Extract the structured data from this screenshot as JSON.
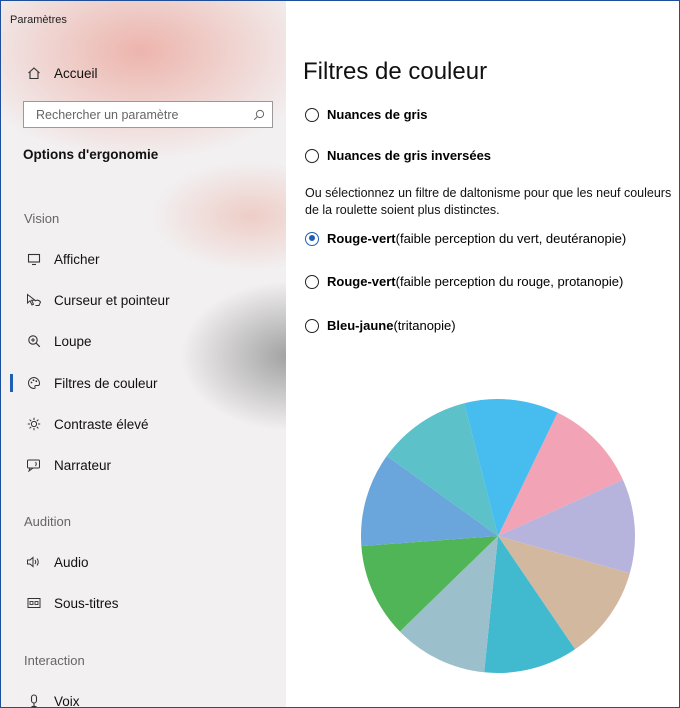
{
  "app": {
    "title": "Paramètres"
  },
  "sidebar": {
    "home": {
      "label": "Accueil",
      "icon": "home-icon"
    },
    "search": {
      "placeholder": "Rechercher un paramètre",
      "icon": "search-icon"
    },
    "group_title": "Options d'ergonomie",
    "sections": [
      {
        "label": "Vision"
      },
      {
        "label": "Audition"
      },
      {
        "label": "Interaction"
      }
    ],
    "items": [
      {
        "label": "Afficher",
        "icon": "monitor-icon"
      },
      {
        "label": "Curseur et pointeur",
        "icon": "pointer-icon"
      },
      {
        "label": "Loupe",
        "icon": "magnifier-icon"
      },
      {
        "label": "Filtres de couleur",
        "icon": "palette-icon",
        "selected": true
      },
      {
        "label": "Contraste élevé",
        "icon": "brightness-icon"
      },
      {
        "label": "Narrateur",
        "icon": "narrator-icon"
      },
      {
        "label": "Audio",
        "icon": "speaker-icon"
      },
      {
        "label": "Sous-titres",
        "icon": "captions-icon"
      },
      {
        "label": "Voix",
        "icon": "microphone-icon"
      }
    ]
  },
  "main": {
    "title": "Filtres de couleur",
    "options": [
      {
        "bold": "Nuances de gris",
        "rest": "",
        "checked": false
      },
      {
        "bold": "Nuances de gris inversées",
        "rest": "",
        "checked": false
      }
    ],
    "description_line1": "Ou sélectionnez un filtre de daltonisme pour que les neuf couleurs",
    "description_line2": "de la roulette soient plus distinctes.",
    "filters": [
      {
        "bold": "Rouge-vert",
        "rest": " (faible perception du vert, deutéranopie)",
        "checked": true
      },
      {
        "bold": "Rouge-vert",
        "rest": " (faible perception du rouge, protanopie)",
        "checked": false
      },
      {
        "bold": "Bleu-jaune",
        "rest": " (tritanopie)",
        "checked": false
      }
    ],
    "color_wheel": {
      "slices": [
        {
          "color": "#f2a3b5"
        },
        {
          "color": "#b6b4dc"
        },
        {
          "color": "#d3b8a0"
        },
        {
          "color": "#41bad0"
        },
        {
          "color": "#9bbfcb"
        },
        {
          "color": "#4fb556"
        },
        {
          "color": "#6aa6dc"
        },
        {
          "color": "#5cc1c9"
        },
        {
          "color": "#46bcef"
        }
      ]
    }
  },
  "colors": {
    "accent": "#1e5fb4",
    "window_border": "#1f4e9b"
  }
}
